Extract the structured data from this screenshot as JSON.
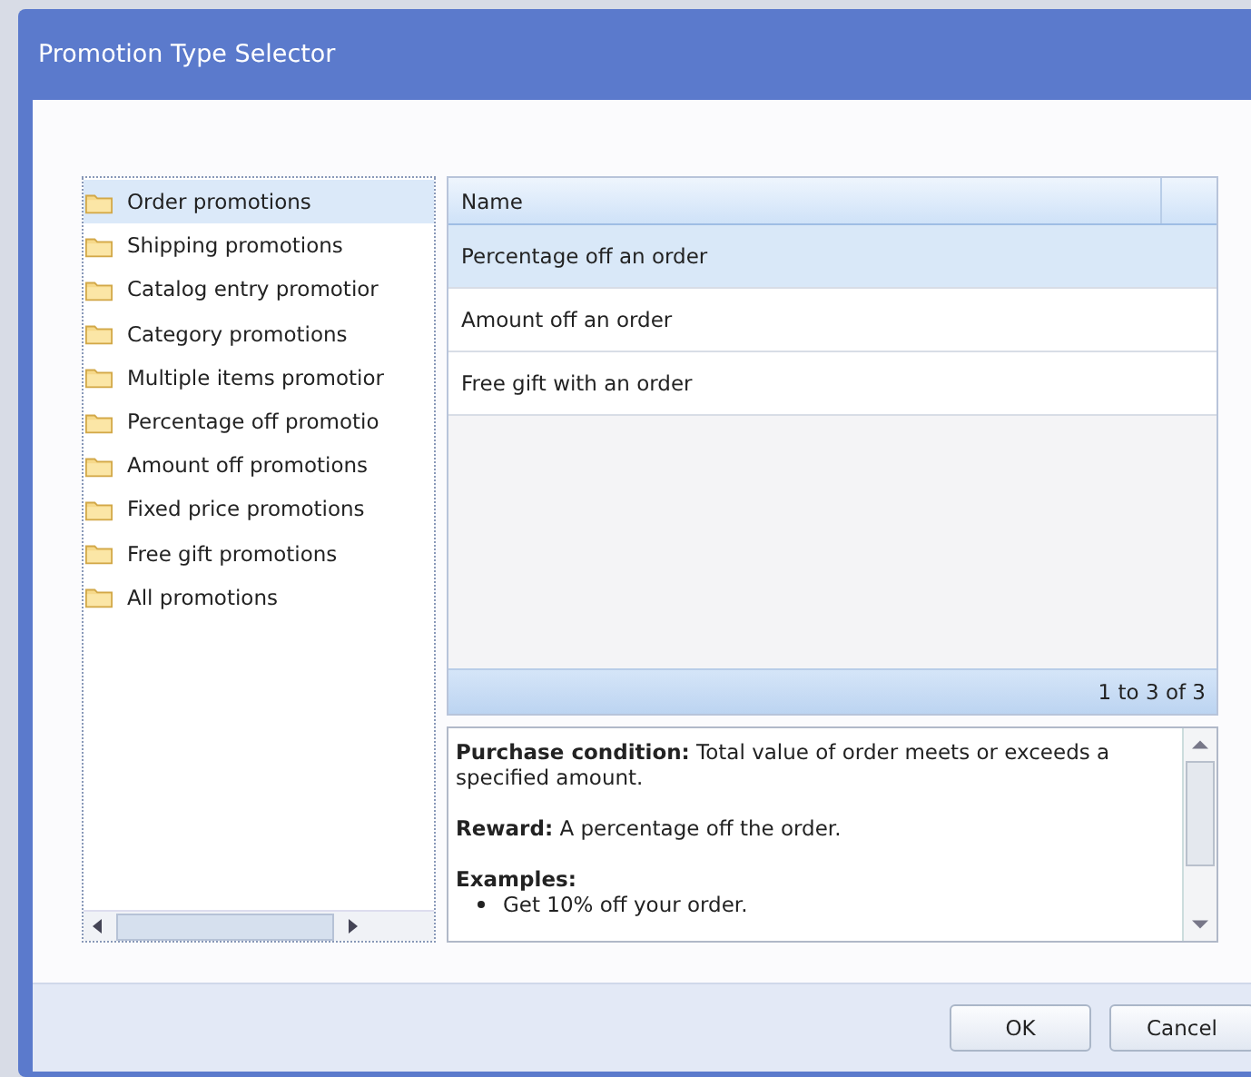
{
  "window": {
    "title": "Promotion Type Selector"
  },
  "tree": {
    "items": [
      {
        "label": "Order promotions",
        "selected": true
      },
      {
        "label": "Shipping promotions",
        "selected": false
      },
      {
        "label": "Catalog entry promotior",
        "selected": false
      },
      {
        "label": "Category promotions",
        "selected": false
      },
      {
        "label": "Multiple items promotior",
        "selected": false
      },
      {
        "label": "Percentage off promotio",
        "selected": false
      },
      {
        "label": "Amount off promotions",
        "selected": false
      },
      {
        "label": "Fixed price promotions",
        "selected": false
      },
      {
        "label": "Free gift promotions",
        "selected": false
      },
      {
        "label": "All promotions",
        "selected": false
      }
    ]
  },
  "table": {
    "columns": [
      "Name"
    ],
    "rows": [
      {
        "name": "Percentage off an order",
        "selected": true
      },
      {
        "name": "Amount off an order",
        "selected": false
      },
      {
        "name": "Free gift with an order",
        "selected": false
      }
    ],
    "paging": "1 to 3 of 3"
  },
  "description": {
    "paragraphs": [
      "**Purchase condition:** Total value of order meets or exceeds a specified amount.",
      "**Reward:** A percentage off the order."
    ],
    "examples_heading": "Examples:",
    "examples": [
      "Get 10% off your order."
    ]
  },
  "buttons": [
    "OK",
    "Cancel"
  ]
}
